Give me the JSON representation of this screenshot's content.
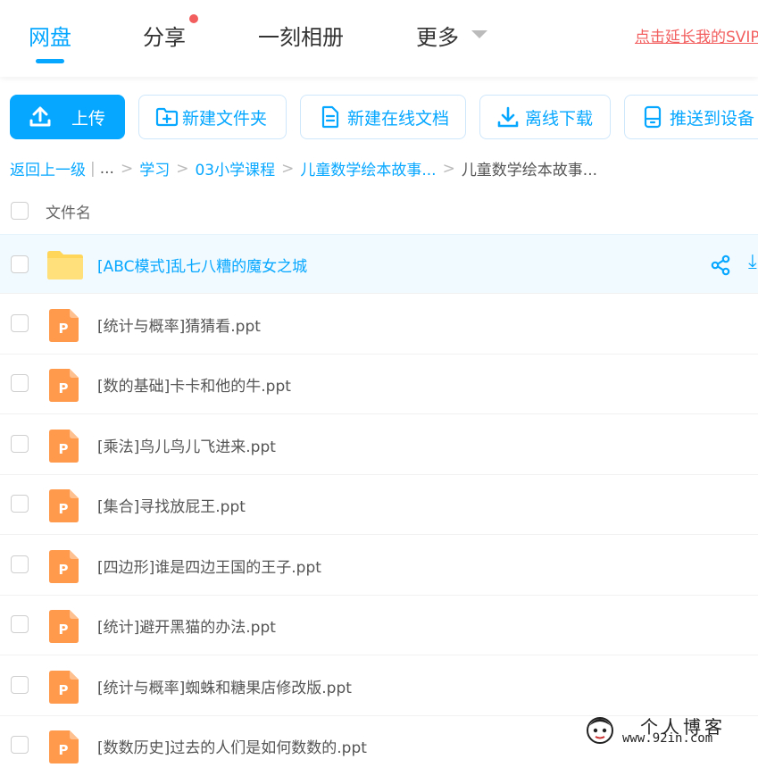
{
  "nav": {
    "tabs": [
      {
        "label": "网盘",
        "active": true
      },
      {
        "label": "分享",
        "badge": true
      },
      {
        "label": "一刻相册"
      },
      {
        "label": "更多"
      }
    ],
    "promo": "点击延长我的SVIP"
  },
  "toolbar": {
    "upload": "上传",
    "new_folder": "新建文件夹",
    "new_doc": "新建在线文档",
    "offline": "离线下载",
    "push": "推送到设备"
  },
  "breadcrumb": {
    "back": "返回上一级",
    "ellipsis": "...",
    "items": [
      "学习",
      "03小学课程",
      "儿童数学绘本故事...",
      "儿童数学绘本故事..."
    ]
  },
  "list": {
    "header": "文件名",
    "rows": [
      {
        "name": "[ABC模式]乱七八糟的魔女之城",
        "type": "folder",
        "highlight": true
      },
      {
        "name": "[统计与概率]猜猜看.ppt",
        "type": "ppt"
      },
      {
        "name": "[数的基础]卡卡和他的牛.ppt",
        "type": "ppt"
      },
      {
        "name": "[乘法]鸟儿鸟儿飞进来.ppt",
        "type": "ppt"
      },
      {
        "name": "[集合]寻找放屁王.ppt",
        "type": "ppt"
      },
      {
        "name": "[四边形]谁是四边王国的王子.ppt",
        "type": "ppt"
      },
      {
        "name": "[统计]避开黑猫的办法.ppt",
        "type": "ppt"
      },
      {
        "name": "[统计与概率]蜘蛛和糖果店修改版.ppt",
        "type": "ppt"
      },
      {
        "name": "[数数历史]过去的人们是如何数数的.ppt",
        "type": "ppt"
      }
    ]
  },
  "watermark": {
    "title": "个人博客",
    "url": "www.92in.com"
  },
  "colors": {
    "accent": "#06a7ff",
    "badge": "#f25d5d",
    "ppt": "#ff9a4d",
    "folder": "#ffd659"
  }
}
